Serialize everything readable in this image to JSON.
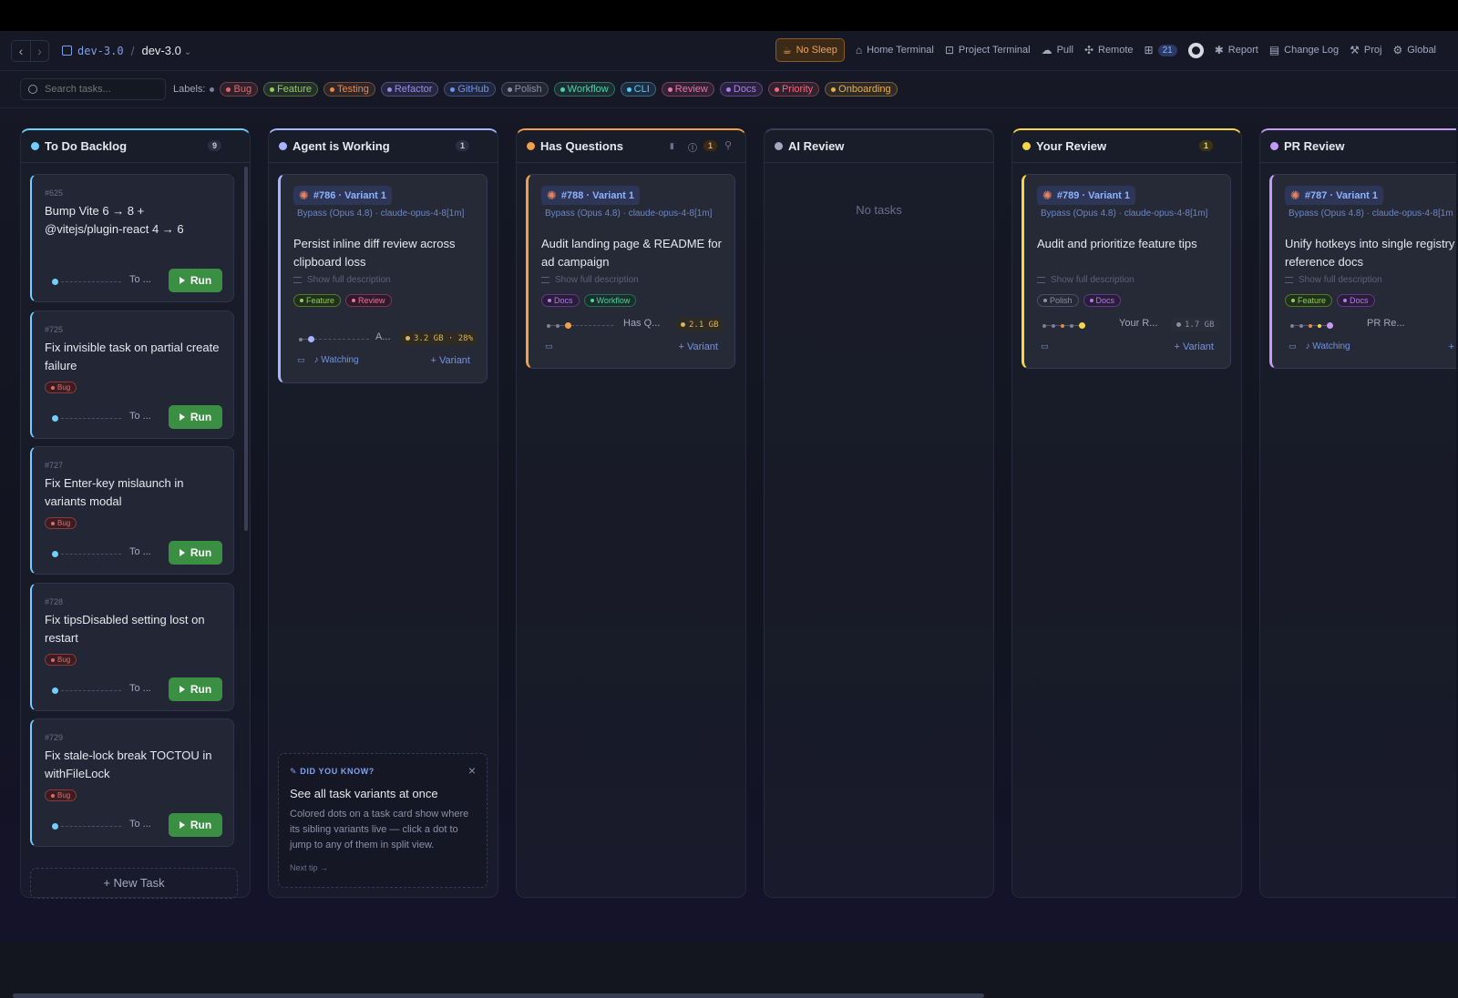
{
  "header": {
    "back": "‹",
    "forward": "›",
    "repo": "dev-3.0",
    "separator": "/",
    "branch": "dev-3.0",
    "no_sleep": "No Sleep",
    "home_terminal": "Home Terminal",
    "project_terminal": "Project Terminal",
    "pull": "Pull",
    "remote": "Remote",
    "badge_count": "21",
    "report": "Report",
    "change_log": "Change Log",
    "proj": "Proj",
    "global": "Global"
  },
  "filters": {
    "search_placeholder": "Search tasks...",
    "labels_title": "Labels:",
    "labels": [
      {
        "name": "Bug",
        "color": "#e06a6a"
      },
      {
        "name": "Feature",
        "color": "#8fcf55"
      },
      {
        "name": "Testing",
        "color": "#e88a4a"
      },
      {
        "name": "Refactor",
        "color": "#9a8af0"
      },
      {
        "name": "GitHub",
        "color": "#6f94ea"
      },
      {
        "name": "Polish",
        "color": "#8a90a6"
      },
      {
        "name": "Workflow",
        "color": "#4fd1a5"
      },
      {
        "name": "CLI",
        "color": "#5ac8fa"
      },
      {
        "name": "Review",
        "color": "#f070a8"
      },
      {
        "name": "Docs",
        "color": "#b47af0"
      },
      {
        "name": "Priority",
        "color": "#f06a7a"
      },
      {
        "name": "Onboarding",
        "color": "#e8b04a"
      }
    ]
  },
  "columns": [
    {
      "title": "To Do Backlog",
      "count": "9",
      "color": "#6fcfff"
    },
    {
      "title": "Agent is Working",
      "count": "1",
      "color": "#a8b4ff"
    },
    {
      "title": "Has Questions",
      "count": "1",
      "color": "#f0a04a"
    },
    {
      "title": "AI Review",
      "count": "",
      "color": "#a3a8bc",
      "empty": "No tasks"
    },
    {
      "title": "Your Review",
      "count": "1",
      "color": "#f5d64a"
    },
    {
      "title": "PR Review",
      "count": "",
      "color": "#c39af5"
    }
  ],
  "backlog": {
    "tasks": [
      {
        "num": "#625",
        "title": "Bump Vite 6 → 8 + @vitejs/plugin-react 4 → 6",
        "label": "",
        "status": "To ...",
        "run": "Run"
      },
      {
        "num": "#725",
        "title": "Fix invisible task on partial create failure",
        "label": "Bug",
        "status": "To ...",
        "run": "Run"
      },
      {
        "num": "#727",
        "title": "Fix Enter-key mislaunch in variants modal",
        "label": "Bug",
        "status": "To ...",
        "run": "Run"
      },
      {
        "num": "#728",
        "title": "Fix tipsDisabled setting lost on restart",
        "label": "Bug",
        "status": "To ...",
        "run": "Run"
      },
      {
        "num": "#729",
        "title": "Fix stale-lock break TOCTOU in withFileLock",
        "label": "Bug",
        "status": "To ...",
        "run": "Run"
      }
    ],
    "new_task": "+ New Task"
  },
  "variant_cards": [
    {
      "head": "#786 · Variant 1",
      "model": "Bypass (Opus 4.8) · claude-opus-4-8[1m]",
      "title": "Persist inline diff review across clipboard loss",
      "show": "Show full description",
      "chips": [
        "Feature",
        "Review"
      ],
      "status": "A...",
      "mem": "3.2 GB · 28%",
      "watching": "Watching",
      "add": "+ Variant"
    },
    {
      "head": "#788 · Variant 1",
      "model": "Bypass (Opus 4.8) · claude-opus-4-8[1m]",
      "title": "Audit landing page & README for ad campaign",
      "show": "Show full description",
      "chips": [
        "Docs",
        "Workflow"
      ],
      "status": "Has Q...",
      "mem": "2.1 GB",
      "watching": "",
      "add": "+ Variant"
    },
    {
      "head": "#789 · Variant 1",
      "model": "Bypass (Opus 4.8) · claude-opus-4-8[1m]",
      "title": "Audit and prioritize feature tips",
      "show": "Show full description",
      "chips": [
        "Polish",
        "Docs"
      ],
      "status": "Your R...",
      "mem": "1.7 GB",
      "watching": "",
      "add": "+ Variant"
    },
    {
      "head": "#787 · Variant 1",
      "model": "Bypass (Opus 4.8) · claude-opus-4-8[1m]",
      "title": "Unify hotkeys into single registry + reference docs",
      "show": "Show full description",
      "chips": [
        "Feature",
        "Docs"
      ],
      "status": "PR Re...",
      "mem": "",
      "watching": "Watching",
      "add": "+"
    }
  ],
  "tip": {
    "kicker": "DID YOU KNOW?",
    "close": "×",
    "title": "See all task variants at once",
    "body": "Colored dots on a task card show where its sibling variants live — click a dot to jump to any of them in split view.",
    "next": "Next tip →"
  }
}
